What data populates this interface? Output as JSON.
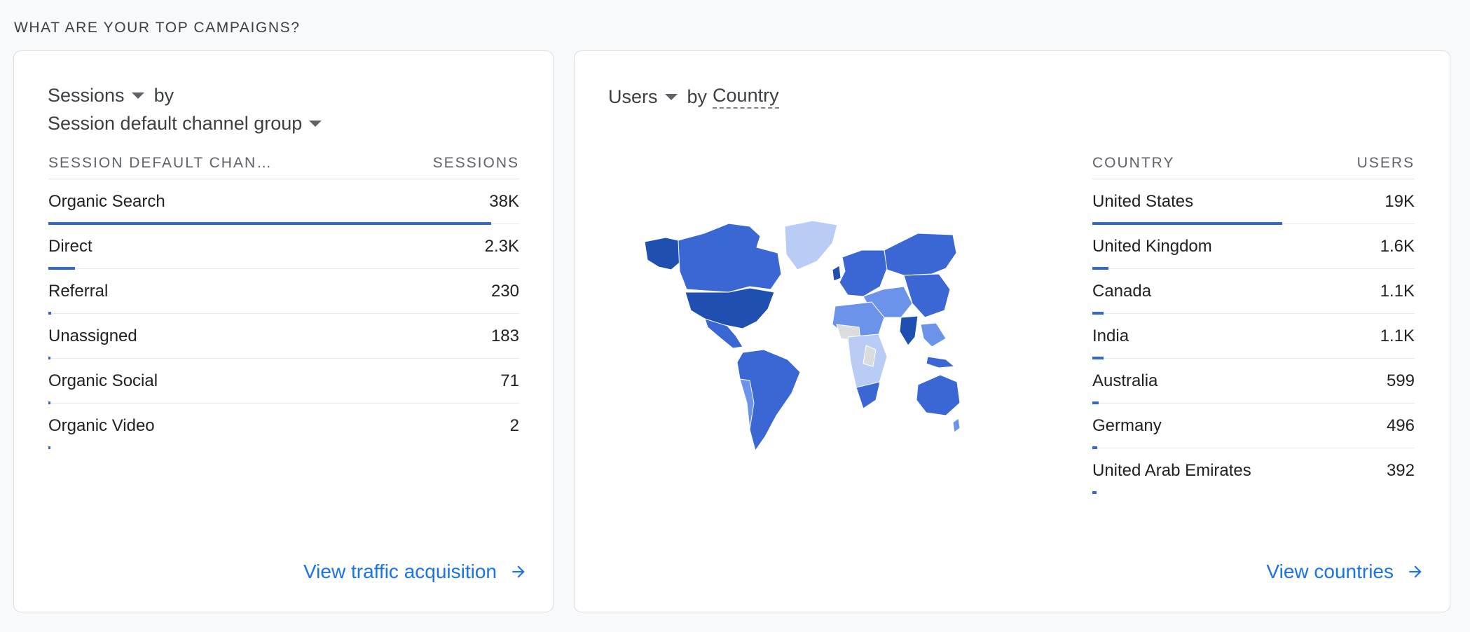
{
  "section_title": "WHAT ARE YOUR TOP CAMPAIGNS?",
  "left_card": {
    "metric": "Sessions",
    "by": "by",
    "dimension": "Session default channel group",
    "table": {
      "col1": "SESSION DEFAULT CHAN…",
      "col2": "SESSIONS",
      "rows": [
        {
          "label": "Organic Search",
          "value": "38K",
          "fraction": 0.94
        },
        {
          "label": "Direct",
          "value": "2.3K",
          "fraction": 0.057
        },
        {
          "label": "Referral",
          "value": "230",
          "fraction": 0.006
        },
        {
          "label": "Unassigned",
          "value": "183",
          "fraction": 0.005
        },
        {
          "label": "Organic Social",
          "value": "71",
          "fraction": 0.002
        },
        {
          "label": "Organic Video",
          "value": "2",
          "fraction": 0
        }
      ]
    },
    "link": "View traffic acquisition"
  },
  "right_card": {
    "metric": "Users",
    "by": "by",
    "dimension": "Country",
    "table": {
      "col1": "COUNTRY",
      "col2": "USERS",
      "rows": [
        {
          "label": "United States",
          "value": "19K",
          "fraction": 0.59
        },
        {
          "label": "United Kingdom",
          "value": "1.6K",
          "fraction": 0.05
        },
        {
          "label": "Canada",
          "value": "1.1K",
          "fraction": 0.035
        },
        {
          "label": "India",
          "value": "1.1K",
          "fraction": 0.035
        },
        {
          "label": "Australia",
          "value": "599",
          "fraction": 0.019
        },
        {
          "label": "Germany",
          "value": "496",
          "fraction": 0.016
        },
        {
          "label": "United Arab Emirates",
          "value": "392",
          "fraction": 0.012
        }
      ]
    },
    "link": "View countries"
  },
  "colors": {
    "accent": "#3366dd",
    "link": "#1a73e8",
    "map_dark": "#1f4fb0",
    "map_mid": "#3a67d4",
    "map_light": "#6b93ea",
    "map_pale": "#b8ccf5",
    "map_none": "#dadce0"
  }
}
